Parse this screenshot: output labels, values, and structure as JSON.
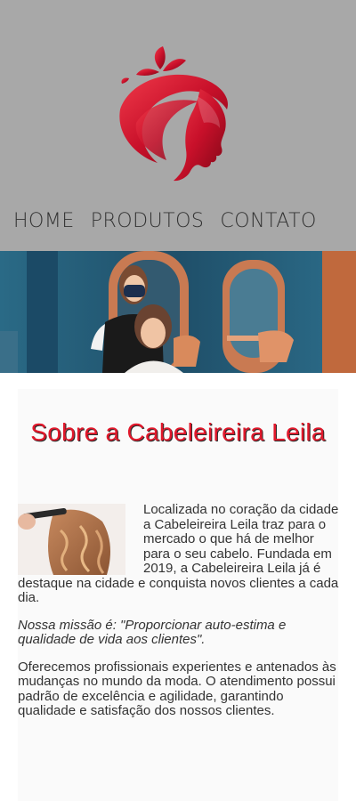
{
  "nav": {
    "items": [
      {
        "label": "HOME"
      },
      {
        "label": "PRODUTOS"
      },
      {
        "label": "CONTATO"
      }
    ]
  },
  "logo": {
    "icon": "woman-hair-logo-icon",
    "color": "#d0142c"
  },
  "hero": {
    "alt_icon": "salon-photo"
  },
  "about": {
    "title": "Sobre a Cabeleireira Leila",
    "paragraph1": "Localizada no coração da cidade a Cabeleireira Leila traz para o mercado o que há de melhor para o seu cabelo. Fundada em 2019, a Cabeleireira Leila já é destaque na cidade e conquista novos clientes a cada dia.",
    "paragraph2": "Nossa missão é: \"Proporcionar auto-estima e qualidade de vida aos clientes\".",
    "paragraph3": "Oferecemos profissionais experientes e antenados às mudanças no mundo da moda. O atendimento possui padrão de excelência e agilidade, garantindo qualidade e satisfação dos nossos clientes."
  },
  "colors": {
    "header_bg": "#a8a8a8",
    "accent": "#e1182b"
  }
}
